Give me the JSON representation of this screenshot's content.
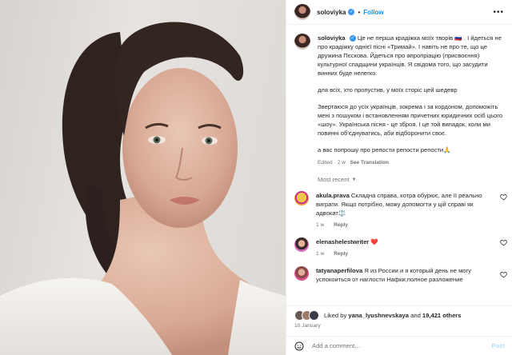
{
  "post": {
    "username": "soloviyka",
    "follow_label": "Follow",
    "caption_paragraphs": [
      "Це не перша крадіжка моїх творів 🇷🇺 . І йдеться не про крадіжку однієї пісні «Тримай». І навіть не про те, що це дружина Пєскова. Йдеться про апропріацію (присвоєння) культурної спадщини українців. Я свідома того, що засудити винних буде нелегко.",
      "для всіх, хто пропустив, у моїх сторіс цей шедевр",
      "Звертаюся до усіх українців, зокрема і за кордоном, допоможіть мені з пошуком і встановленням причетних юридичних осіб цього «шоу». Українська пісня - це зброя. І це той випадок, коли ми повинні об'єднуватись, аби відборонити своє.",
      "а вас попрошу про репости репости репости🙏"
    ],
    "caption_meta": {
      "edited": "Edited",
      "age": "2 w",
      "see_translation": "See Translation"
    },
    "most_recent_label": "Most recent"
  },
  "comments": [
    {
      "user": "akula.prava",
      "text": "Складна справа, котра обурює, але її реально виграти. Якщо потрібно, можу допомогти у цій справі як адвокат⚖️",
      "age": "1 w",
      "reply": "Reply"
    },
    {
      "user": "elenashelestwriter",
      "text": "❤️",
      "age": "1 w",
      "reply": "Reply"
    },
    {
      "user": "tatyanaperfilova",
      "text": "Я из России и я который день не могу успокоиться от наглости Нафки,полное разложение",
      "age": "",
      "reply": ""
    }
  ],
  "likes": {
    "liked_by_prefix": "Liked by",
    "liked_by_user": "yana_lyushnevskaya",
    "and": "and",
    "others": "19,421 others"
  },
  "date": "10 January",
  "add_comment": {
    "placeholder": "Add a comment…",
    "post_label": "Post"
  },
  "colors": {
    "accent": "#0095f6",
    "verified": "#3897f0",
    "muted": "#737373",
    "like_red": "#ed4956"
  },
  "icons": {
    "verified": "verified-badge-icon",
    "more": "more-options-icon",
    "heart": "heart-icon",
    "emoji": "emoji-icon"
  }
}
